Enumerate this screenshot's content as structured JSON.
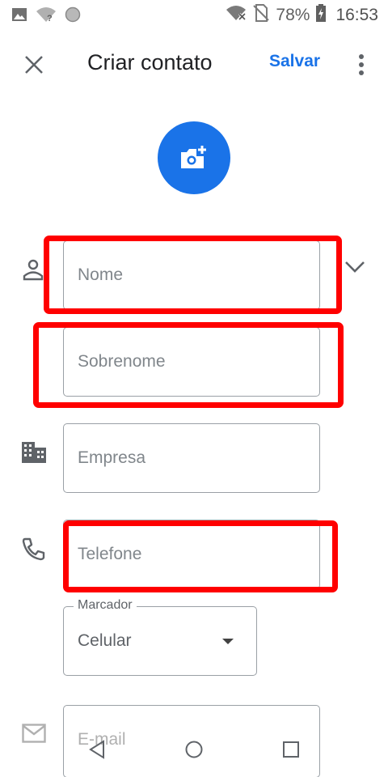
{
  "status_bar": {
    "battery_text": "78%",
    "time": "16:53",
    "icons": [
      "image-icon",
      "wifi-question-icon",
      "circle-icon",
      "wifi-off-icon",
      "no-sim-icon",
      "battery-icon"
    ]
  },
  "app_bar": {
    "title": "Criar contato",
    "save_label": "Salvar",
    "icons": [
      "close-icon",
      "more-vert-icon"
    ]
  },
  "photo": {
    "icon": "add-photo-icon",
    "color": "#1a73e8"
  },
  "form": {
    "name_placeholder": "Nome",
    "surname_placeholder": "Sobrenome",
    "company_placeholder": "Empresa",
    "phone_placeholder": "Telefone",
    "phone_label_caption": "Marcador",
    "phone_label_value": "Celular",
    "email_placeholder": "E-mail",
    "icons": [
      "person-icon",
      "chevron-down-icon",
      "company-icon",
      "phone-icon",
      "email-icon",
      "dropdown-arrow-icon"
    ]
  },
  "highlights": {
    "color": "#ff0000",
    "targets": [
      "name-field",
      "surname-field",
      "phone-field"
    ]
  },
  "nav_bar": {
    "icons": [
      "back-icon",
      "home-icon",
      "recents-icon"
    ]
  },
  "colors": {
    "accent": "#1a73e8",
    "highlight": "#ff0000",
    "text": "#202124",
    "hint": "#80868b"
  }
}
